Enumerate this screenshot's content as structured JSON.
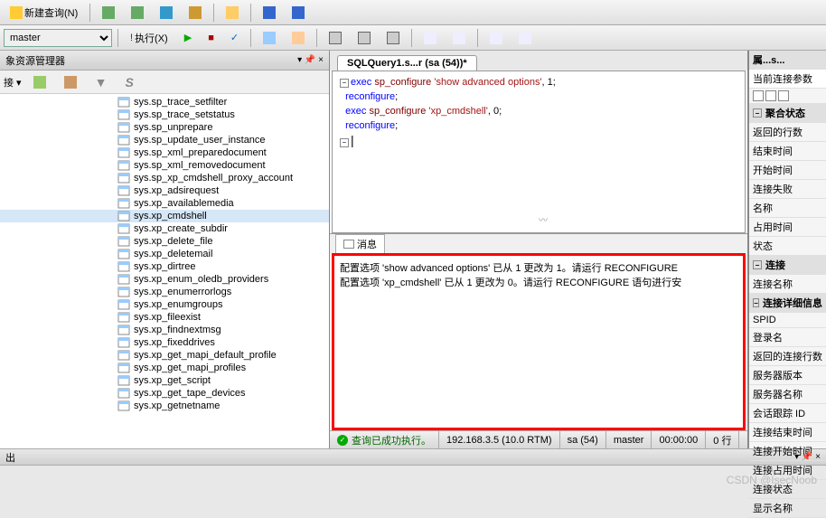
{
  "toolbar": {
    "new_query": "新建查询(N)",
    "execute": "执行(X)",
    "db_dropdown": "master"
  },
  "left_panel": {
    "title": "象资源管理器",
    "connect_label": "接 ▾",
    "tree_items": [
      {
        "name": "sys.sp_trace_setfilter",
        "selected": false
      },
      {
        "name": "sys.sp_trace_setstatus",
        "selected": false
      },
      {
        "name": "sys.sp_unprepare",
        "selected": false
      },
      {
        "name": "sys.sp_update_user_instance",
        "selected": false
      },
      {
        "name": "sys.sp_xml_preparedocument",
        "selected": false
      },
      {
        "name": "sys.sp_xml_removedocument",
        "selected": false
      },
      {
        "name": "sys.sp_xp_cmdshell_proxy_account",
        "selected": false
      },
      {
        "name": "sys.xp_adsirequest",
        "selected": false
      },
      {
        "name": "sys.xp_availablemedia",
        "selected": false
      },
      {
        "name": "sys.xp_cmdshell",
        "selected": true
      },
      {
        "name": "sys.xp_create_subdir",
        "selected": false
      },
      {
        "name": "sys.xp_delete_file",
        "selected": false
      },
      {
        "name": "sys.xp_deletemail",
        "selected": false
      },
      {
        "name": "sys.xp_dirtree",
        "selected": false
      },
      {
        "name": "sys.xp_enum_oledb_providers",
        "selected": false
      },
      {
        "name": "sys.xp_enumerrorlogs",
        "selected": false
      },
      {
        "name": "sys.xp_enumgroups",
        "selected": false
      },
      {
        "name": "sys.xp_fileexist",
        "selected": false
      },
      {
        "name": "sys.xp_findnextmsg",
        "selected": false
      },
      {
        "name": "sys.xp_fixeddrives",
        "selected": false
      },
      {
        "name": "sys.xp_get_mapi_default_profile",
        "selected": false
      },
      {
        "name": "sys.xp_get_mapi_profiles",
        "selected": false
      },
      {
        "name": "sys.xp_get_script",
        "selected": false
      },
      {
        "name": "sys.xp_get_tape_devices",
        "selected": false
      },
      {
        "name": "sys.xp_getnetname",
        "selected": false
      }
    ]
  },
  "center": {
    "tab_title": "SQLQuery1.s...r (sa (54))*",
    "sql": {
      "line1_kw": "exec",
      "line1_proc": "sp_configure",
      "line1_str": "'show advanced options'",
      "line1_num": "1",
      "line2_kw": "reconfigure",
      "line3_kw": "exec",
      "line3_proc": "sp_configure",
      "line3_str": "'xp_cmdshell'",
      "line3_num": "0",
      "line4_kw": "reconfigure"
    },
    "msg_tab": "消息",
    "messages": {
      "line1": "配置选项 'show advanced options' 已从 1 更改为 1。请运行 RECONFIGURE",
      "line2": "配置选项 'xp_cmdshell' 已从 1 更改为 0。请运行 RECONFIGURE 语句进行安"
    }
  },
  "status": {
    "success": "查询已成功执行。",
    "server": "192.168.3.5 (10.0 RTM)",
    "user": "sa (54)",
    "db": "master",
    "time": "00:00:00",
    "rows": "0 行"
  },
  "right_panel": {
    "header1": "属...s...",
    "header2": "当前连接参数",
    "sections": [
      {
        "title": "聚合状态",
        "items": [
          "返回的行数",
          "结束时间",
          "开始时间",
          "连接失败",
          "名称",
          "占用时间",
          "状态"
        ]
      },
      {
        "title": "连接",
        "items": [
          "连接名称"
        ]
      },
      {
        "title": "连接详细信息",
        "items": [
          "SPID",
          "登录名",
          "返回的连接行数",
          "服务器版本",
          "服务器名称",
          "会话跟踪 ID",
          "连接结束时间",
          "连接开始时间",
          "连接占用时间",
          "连接状态",
          "显示名称"
        ]
      }
    ]
  },
  "bottom": {
    "label": "出"
  },
  "watermark": "CSDN @IsecNoob"
}
